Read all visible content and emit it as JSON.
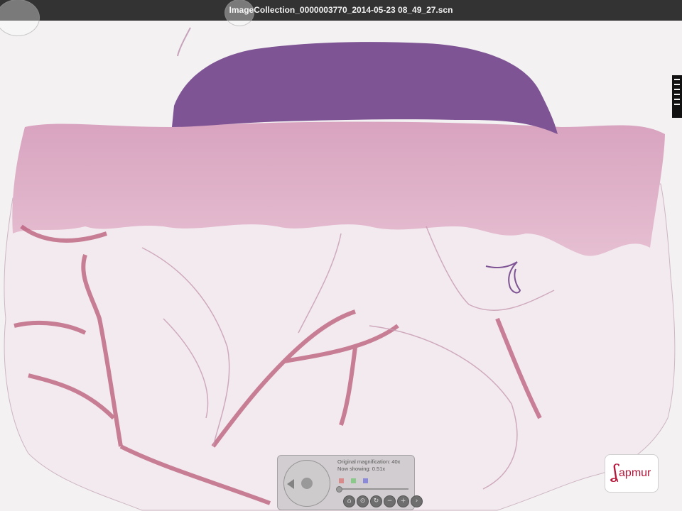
{
  "window": {
    "title": "ImageCollection_0000003770_2014-05-23 08_49_27.scn"
  },
  "navigator": {
    "original_magnification": "Original magnification: 40x",
    "now_showing": "Now showing: 0.51x",
    "channel_colors": [
      "#d98a8a",
      "#8ac98a",
      "#8a8ad9"
    ],
    "zoom_fraction": 0.0,
    "tools": [
      {
        "name": "home-icon",
        "glyph": "⌂"
      },
      {
        "name": "fullscreen-icon",
        "glyph": "⊙"
      },
      {
        "name": "rotate-icon",
        "glyph": "↻"
      },
      {
        "name": "zoom-out-icon",
        "glyph": "−"
      },
      {
        "name": "zoom-in-icon",
        "glyph": "+"
      },
      {
        "name": "next-icon",
        "glyph": "›"
      }
    ]
  },
  "logo": {
    "mark": "ʆ",
    "text": "apmur",
    "color": "#b5163a"
  },
  "colors": {
    "titlebar": "#333333",
    "background": "#f3f1f2",
    "epidermis": "#7e5494",
    "dermis": "#d7a6bf",
    "fat": "#f1e8ee",
    "septa": "#b95a78"
  }
}
